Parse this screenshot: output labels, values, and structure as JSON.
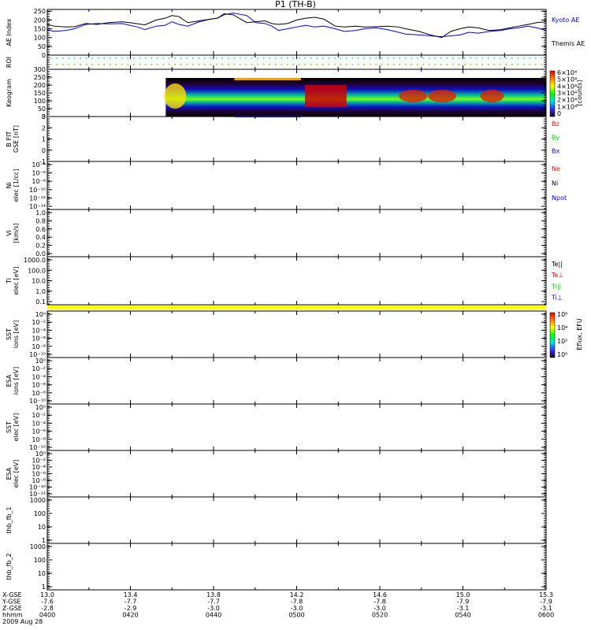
{
  "chart_data": {
    "type": "line",
    "title": "P1 (TH-B)",
    "date_label": "2009 Aug 28",
    "x_axis": {
      "rows": [
        {
          "label": "X-GSE",
          "values": [
            "13.0",
            "13.4",
            "13.8",
            "14.2",
            "14.6",
            "15.0",
            "15.3"
          ]
        },
        {
          "label": "Y-GSE",
          "values": [
            "-7.6",
            "-7.7",
            "-7.7",
            "-7.8",
            "-7.8",
            "-7.9",
            "-7.9"
          ]
        },
        {
          "label": "Z-GSE",
          "values": [
            "-2.8",
            "-2.9",
            "-3.0",
            "-3.0",
            "-3.0",
            "-3.1",
            "-3.1"
          ]
        },
        {
          "label": "hhmm",
          "values": [
            "0400",
            "0420",
            "0440",
            "0500",
            "0520",
            "0540",
            "0600"
          ]
        }
      ],
      "range_minutes": [
        0,
        120
      ]
    },
    "panels": [
      {
        "id": "ae",
        "ylabel": "AE Index",
        "ylim": [
          0,
          260
        ],
        "ticks": [
          "250",
          "200",
          "150",
          "100",
          "50",
          "0"
        ],
        "tickvals": [
          250,
          200,
          150,
          100,
          50,
          0
        ],
        "series": [
          {
            "name": "Kyoto AE",
            "color": "#0000ff",
            "x": [
              0,
              3,
              8,
              12,
              17,
              22,
              27,
              33,
              38,
              40,
              43,
              48,
              52,
              55,
              58,
              62,
              67,
              72,
              75,
              78,
              82,
              86,
              88,
              92,
              96,
              99,
              102,
              106,
              110,
              114,
              118,
              122,
              127,
              131,
              136,
              140,
              145,
              150,
              155,
              158,
              164,
              169,
              174,
              178,
              182,
              186,
              190,
              195,
              200,
              204,
              208,
              212,
              216,
              220
            ],
            "y": [
              145,
              135,
              140,
              150,
              175,
              180,
              178,
              180,
              165,
              160,
              145,
              165,
              170,
              190,
              175,
              165,
              190,
              205,
              210,
              230,
              240,
              230,
              225,
              185,
              180,
              165,
              140,
              150,
              160,
              170,
              160,
              165,
              150,
              135,
              140,
              150,
              155,
              145,
              130,
              120,
              115,
              110,
              105,
              110,
              115,
              130,
              125,
              135,
              140,
              150,
              155,
              165,
              155,
              140
            ]
          },
          {
            "name": "Themis AE",
            "color": "#000000",
            "x": [
              0,
              3,
              8,
              12,
              17,
              22,
              27,
              33,
              38,
              40,
              43,
              48,
              52,
              55,
              58,
              62,
              67,
              72,
              75,
              78,
              82,
              86,
              88,
              92,
              96,
              99,
              102,
              106,
              110,
              114,
              118,
              122,
              127,
              131,
              136,
              140,
              145,
              150,
              155,
              158,
              164,
              169,
              174,
              178,
              182,
              186,
              190,
              195,
              200,
              204,
              208,
              212,
              216,
              220
            ],
            "y": [
              175,
              165,
              160,
              162,
              180,
              175,
              185,
              190,
              182,
              178,
              172,
              200,
              210,
              225,
              220,
              185,
              195,
              205,
              210,
              235,
              230,
              200,
              185,
              190,
              195,
              180,
              175,
              180,
              200,
              210,
              215,
              205,
              165,
              160,
              165,
              160,
              162,
              165,
              160,
              150,
              135,
              115,
              100,
              135,
              150,
              160,
              155,
              140,
              145,
              155,
              165,
              175,
              185,
              190
            ]
          }
        ]
      },
      {
        "id": "roi",
        "ylabel": "ROI",
        "ticks": [],
        "tickvals": []
      },
      {
        "id": "keogram",
        "ylabel": "Keogram",
        "ylim": [
          0,
          300
        ],
        "ticks": [
          "300",
          "250",
          "200",
          "150",
          "100",
          "50",
          "0"
        ],
        "tickvals": [
          300,
          250,
          200,
          150,
          100,
          50,
          0
        ],
        "colorbar": {
          "label": "[counts]",
          "ticks": [
            "6×10⁴",
            "5×10⁴",
            "4×10⁴",
            "3×10⁴",
            "2×10⁴",
            "1×10⁴",
            "0"
          ]
        }
      },
      {
        "id": "bfit",
        "ylabel": "B FIT",
        "sublabel": "GSE [nT]",
        "ylim": [
          -1,
          3
        ],
        "ticks": [
          "3",
          "2",
          "1",
          "0",
          "-1"
        ],
        "tickvals": [
          3,
          2,
          1,
          0,
          -1
        ],
        "legend": [
          {
            "name": "Bz",
            "color": "#ff0000"
          },
          {
            "name": "By",
            "color": "#00cc00"
          },
          {
            "name": "Bx",
            "color": "#0000ff"
          }
        ]
      },
      {
        "id": "ni",
        "ylabel": "Ni",
        "sublabel": "elec [1/cc]",
        "ticks": [
          "10⁻⁴",
          "10⁻⁶",
          "10⁻⁸",
          "10⁻¹⁰",
          "10⁻¹²",
          "10⁻¹⁴"
        ],
        "legend": [
          {
            "name": "Ne",
            "color": "#ff0000"
          },
          {
            "name": "Ni",
            "color": "#000000"
          },
          {
            "name": "Npot",
            "color": "#0000ff"
          }
        ]
      },
      {
        "id": "vi",
        "ylabel": "Vi",
        "sublabel": "[km/s]",
        "ticks": [
          "1.0",
          "0.8",
          "0.6",
          "0.4",
          "0.2",
          "0.0"
        ]
      },
      {
        "id": "ti",
        "ylabel": "Ti",
        "sublabel": "elec [eV]",
        "ticks": [
          "1000.0",
          "100.0",
          "10.0",
          "1.0",
          "0.1"
        ],
        "legend": [
          {
            "name": "Te||",
            "color": "#000000"
          },
          {
            "name": "Te⊥",
            "color": "#ff0000"
          },
          {
            "name": "Ti||",
            "color": "#00cc00"
          },
          {
            "name": "Ti⊥",
            "color": "#0000ff"
          }
        ]
      },
      {
        "id": "sst_i",
        "ylabel": "SST",
        "sublabel": "ions [eV]",
        "ticks": [
          "10⁰",
          "10⁻²",
          "10⁻⁴",
          "10⁻⁶",
          "10⁻⁸",
          "10⁻¹⁰"
        ],
        "colorbar": {
          "label": "Eflux, EFU",
          "ticks": [
            "10⁶",
            "10⁴",
            "10²",
            "10⁰"
          ]
        }
      },
      {
        "id": "esa_i",
        "ylabel": "ESA",
        "sublabel": "ions [eV]",
        "ticks": [
          "10⁰",
          "10⁻²",
          "10⁻⁴",
          "10⁻⁶",
          "10⁻⁸",
          "10⁻¹⁰"
        ]
      },
      {
        "id": "sst_e",
        "ylabel": "SST",
        "sublabel": "elec [eV]",
        "ticks": [
          "10⁰",
          "10⁻²",
          "10⁻⁴",
          "10⁻⁶",
          "10⁻⁸",
          "10⁻¹⁰"
        ]
      },
      {
        "id": "esa_e",
        "ylabel": "ESA",
        "sublabel": "elec [eV]",
        "ticks": [
          "10⁰",
          "10⁻²",
          "10⁻⁴",
          "10⁻⁶",
          "10⁻⁸",
          "10⁻¹⁰",
          "10⁻¹²"
        ]
      },
      {
        "id": "fb1",
        "ylabel": "thb_fb_1",
        "ticks": [
          "1000",
          "100",
          "10",
          "1"
        ]
      },
      {
        "id": "fb2",
        "ylabel": "thb_fb_2",
        "ticks": [
          "1000",
          "100",
          "10",
          "1"
        ]
      }
    ]
  }
}
